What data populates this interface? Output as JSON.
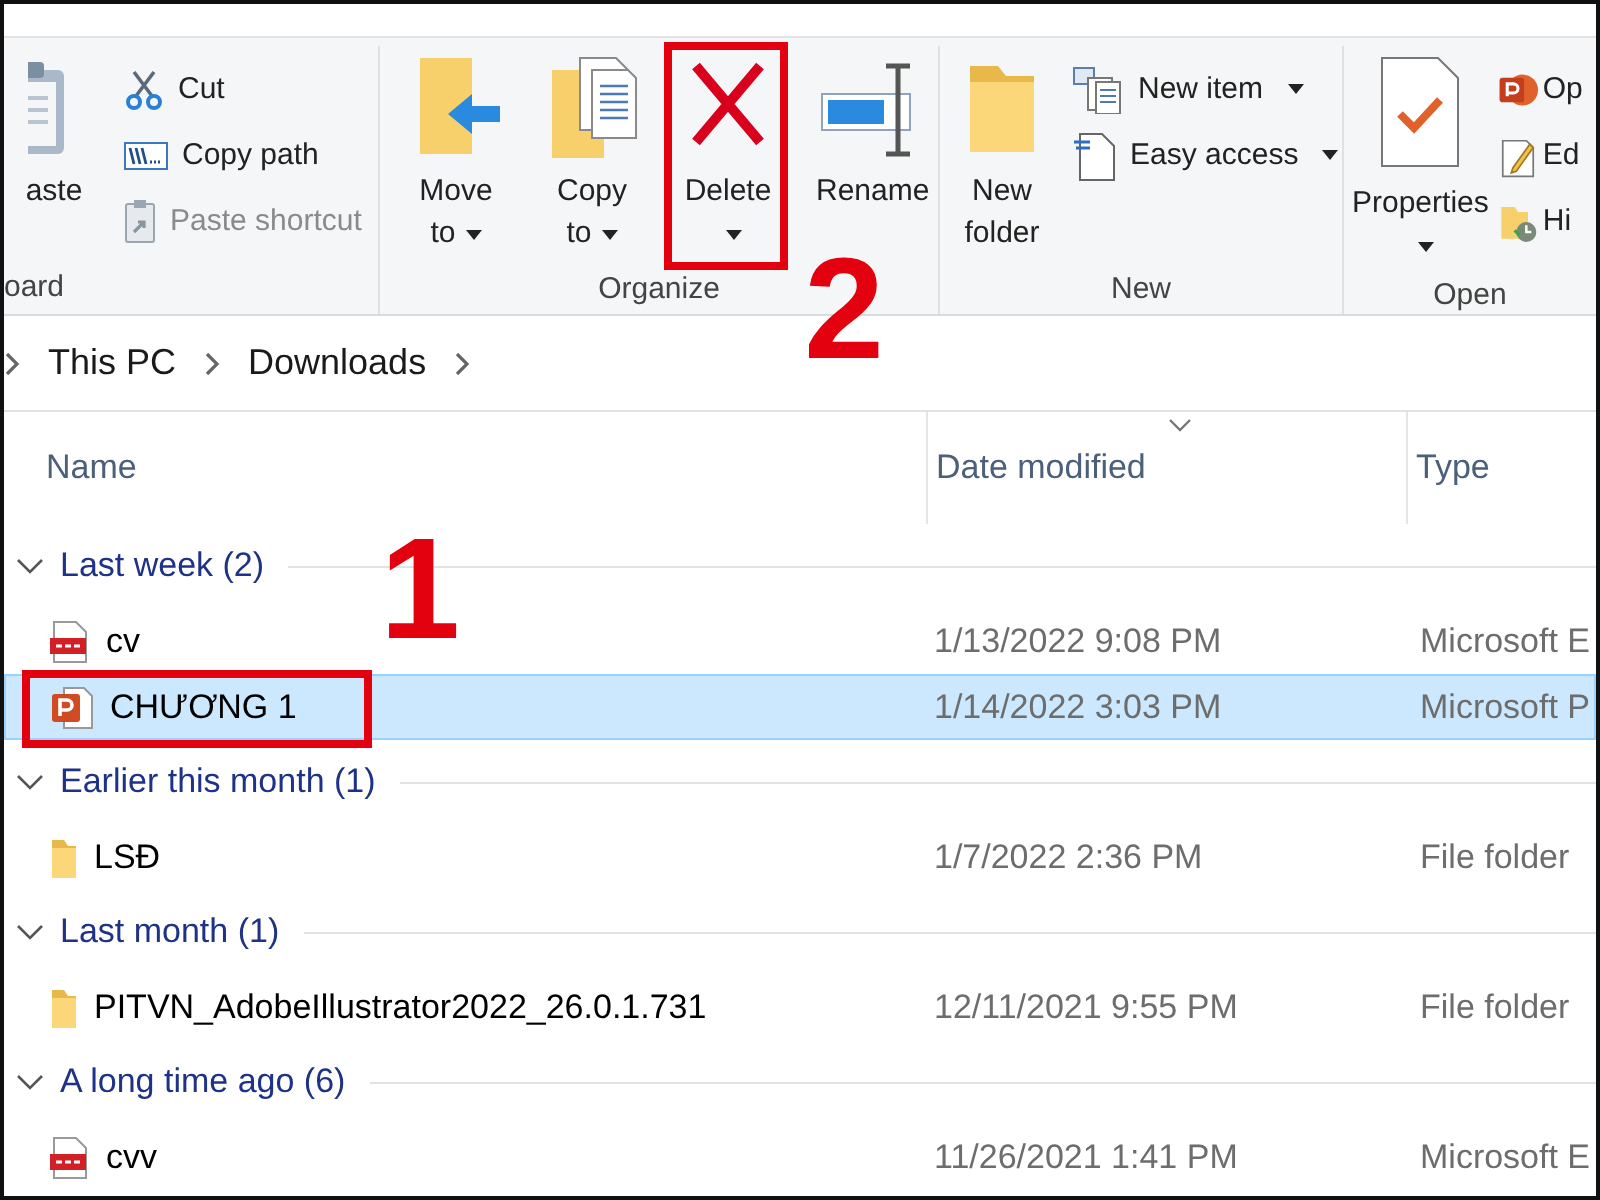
{
  "ribbon": {
    "groups": [
      {
        "label": "oard",
        "commands": [
          {
            "kind": "large",
            "label": "aste",
            "dropdown": false,
            "disabled": false,
            "highlighted": false
          },
          {
            "kind": "small",
            "label": "Cut",
            "dropdown": false,
            "disabled": false,
            "highlighted": false
          },
          {
            "kind": "small",
            "label": "Copy path",
            "dropdown": false,
            "disabled": false,
            "highlighted": false
          },
          {
            "kind": "small",
            "label": "Paste shortcut",
            "dropdown": false,
            "disabled": true,
            "highlighted": false
          }
        ]
      },
      {
        "label": "Organize",
        "commands": [
          {
            "kind": "large",
            "label": "Move to",
            "dropdown": true,
            "disabled": false,
            "highlighted": false
          },
          {
            "kind": "large",
            "label": "Copy to",
            "dropdown": true,
            "disabled": false,
            "highlighted": false
          },
          {
            "kind": "large",
            "label": "Delete",
            "dropdown": true,
            "disabled": false,
            "highlighted": true,
            "step": "2"
          },
          {
            "kind": "large",
            "label": "Rename",
            "dropdown": false,
            "disabled": false,
            "highlighted": false
          }
        ]
      },
      {
        "label": "New",
        "commands": [
          {
            "kind": "large",
            "label": "New folder",
            "dropdown": false,
            "disabled": false,
            "highlighted": false
          },
          {
            "kind": "small",
            "label": "New item",
            "dropdown": true,
            "disabled": false,
            "highlighted": false
          },
          {
            "kind": "small",
            "label": "Easy access",
            "dropdown": true,
            "disabled": false,
            "highlighted": false
          }
        ]
      },
      {
        "label": "Open",
        "commands": [
          {
            "kind": "large",
            "label": "Properties",
            "dropdown": true,
            "disabled": false,
            "highlighted": false
          },
          {
            "kind": "small",
            "label": "Op",
            "dropdown": false,
            "disabled": false,
            "highlighted": false
          },
          {
            "kind": "small",
            "label": "Ed",
            "dropdown": false,
            "disabled": false,
            "highlighted": false
          },
          {
            "kind": "small",
            "label": "Hi",
            "dropdown": false,
            "disabled": false,
            "highlighted": false
          }
        ]
      }
    ]
  },
  "address_bar": {
    "segments": [
      "This PC",
      "Downloads"
    ]
  },
  "file_list": {
    "columns": [
      {
        "label": "Name",
        "sorted": false
      },
      {
        "label": "Date modified",
        "sorted": true
      },
      {
        "label": "Type",
        "sorted": false
      }
    ],
    "groups": [
      {
        "label": "Last week (2)",
        "expanded": true,
        "files": [
          {
            "kind": "pdf",
            "name": "cv",
            "date": "1/13/2022 9:08 PM",
            "type": "Microsoft E",
            "selected": false,
            "highlighted": false
          },
          {
            "kind": "ppt",
            "name": "CHƯƠNG 1",
            "date": "1/14/2022 3:03 PM",
            "type": "Microsoft P",
            "selected": true,
            "highlighted": true,
            "step": "1"
          }
        ]
      },
      {
        "label": "Earlier this month (1)",
        "expanded": true,
        "files": [
          {
            "kind": "folder",
            "name": "LSĐ",
            "date": "1/7/2022 2:36 PM",
            "type": "File folder",
            "selected": false,
            "highlighted": false
          }
        ]
      },
      {
        "label": "Last month (1)",
        "expanded": true,
        "files": [
          {
            "kind": "folder",
            "name": "PITVN_AdobeIllustrator2022_26.0.1.731",
            "date": "12/11/2021 9:55 PM",
            "type": "File folder",
            "selected": false,
            "highlighted": false
          }
        ]
      },
      {
        "label": "A long time ago (6)",
        "expanded": true,
        "files": [
          {
            "kind": "pdf",
            "name": "cvv",
            "date": "11/26/2021 1:41 PM",
            "type": "Microsoft E",
            "selected": false,
            "highlighted": false
          }
        ]
      }
    ]
  }
}
